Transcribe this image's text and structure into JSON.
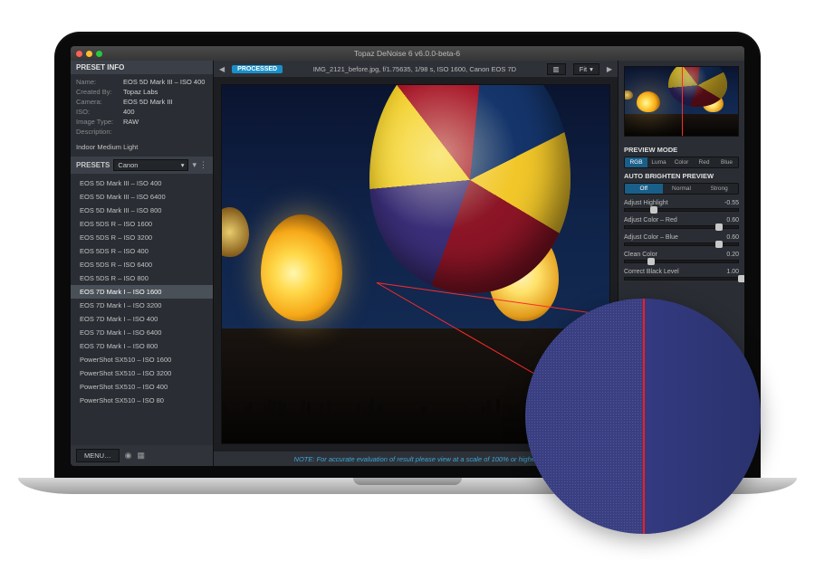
{
  "window": {
    "title": "Topaz DeNoise 6 v6.0.0-beta-6"
  },
  "preset_info": {
    "header": "PRESET INFO",
    "rows": {
      "name_k": "Name:",
      "name_v": "EOS 5D Mark III – ISO 400",
      "createdby_k": "Created By:",
      "createdby_v": "Topaz Labs",
      "camera_k": "Camera:",
      "camera_v": "EOS 5D Mark III",
      "iso_k": "ISO:",
      "iso_v": "400",
      "imgtype_k": "Image Type:",
      "imgtype_v": "RAW",
      "desc_k": "Description:"
    },
    "description": "Indoor Medium Light"
  },
  "presets": {
    "header": "PRESETS",
    "dropdown_value": "Canon",
    "items": [
      "EOS 5D Mark III – ISO 400",
      "EOS 5D Mark III – ISO 6400",
      "EOS 5D Mark III – ISO 800",
      "EOS 5DS R – ISO 1600",
      "EOS 5DS R – ISO 3200",
      "EOS 5DS R – ISO 400",
      "EOS 5DS R – ISO 6400",
      "EOS 5DS R – ISO 800",
      "EOS 7D Mark I – ISO 1600",
      "EOS 7D Mark I – ISO 3200",
      "EOS 7D Mark I – ISO 400",
      "EOS 7D Mark I – ISO 6400",
      "EOS 7D Mark I – ISO 800",
      "PowerShot SX510 – ISO 1600",
      "PowerShot SX510 – ISO 3200",
      "PowerShot SX510 – ISO 400",
      "PowerShot SX510 – ISO 80"
    ],
    "selected_index": 8
  },
  "left_footer": {
    "menu": "MENU…"
  },
  "toolbar": {
    "processed": "PROCESSED",
    "filename": "IMG_2121_before.jpg, f/1.75635, 1/98 s, ISO 1600, Canon EOS 7D",
    "zoom": "Fit"
  },
  "note": "NOTE:   For accurate evaluation of result please view at a scale of 100% or higher",
  "right": {
    "preview_mode_label": "PREVIEW MODE",
    "preview_modes": [
      "RGB",
      "Luma",
      "Color",
      "Red",
      "Blue"
    ],
    "preview_selected": 0,
    "auto_brighten_label": "AUTO BRIGHTEN PREVIEW",
    "auto_brighten_opts": [
      "Off",
      "Normal",
      "Strong"
    ],
    "auto_brighten_selected": 0,
    "sliders": [
      {
        "label": "Adjust Highlight",
        "value": "-0.55",
        "pos": 22
      },
      {
        "label": "Adjust Color – Red",
        "value": "0.60",
        "pos": 80
      },
      {
        "label": "Adjust Color – Blue",
        "value": "0.60",
        "pos": 80
      },
      {
        "label": "Clean Color",
        "value": "0.20",
        "pos": 20
      },
      {
        "label": "Correct Black Level",
        "value": "1.00",
        "pos": 100
      }
    ]
  }
}
